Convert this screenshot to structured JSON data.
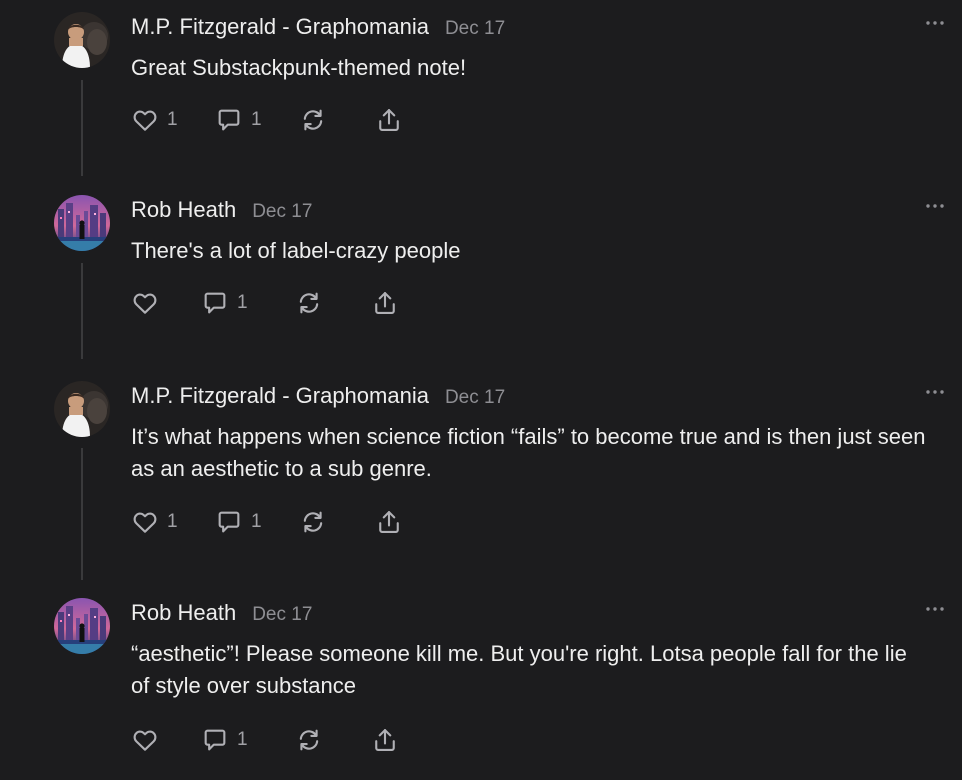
{
  "comments": [
    {
      "author": "M.P. Fitzgerald - Graphomania",
      "date": "Dec 17",
      "avatar_icon": "man-with-dog-avatar",
      "text": "Great Substackpunk-themed note!",
      "likes": "1",
      "replies": "1"
    },
    {
      "author": "Rob Heath",
      "date": "Dec 17",
      "avatar_icon": "cyberpunk-city-avatar",
      "text": "There's a lot of label-crazy people",
      "likes": "",
      "replies": "1"
    },
    {
      "author": "M.P. Fitzgerald - Graphomania",
      "date": "Dec 17",
      "avatar_icon": "man-with-dog-avatar",
      "text": "It’s what happens when science fiction “fails” to become true and is then just seen as an aesthetic to a sub genre.",
      "likes": "1",
      "replies": "1"
    },
    {
      "author": "Rob Heath",
      "date": "Dec 17",
      "avatar_icon": "cyberpunk-city-avatar",
      "text": "“aesthetic”! Please someone kill me. But you're right. Lotsa people fall for the lie of style over substance",
      "likes": "",
      "replies": "1"
    }
  ],
  "icons": {
    "like": "heart-icon",
    "reply": "comment-bubble-icon",
    "restack": "restack-arrows-icon",
    "share": "share-upload-icon",
    "more": "more-dots-icon"
  },
  "colors": {
    "background": "#1c1c1e",
    "text": "#eeeeee",
    "muted": "#8e8e93",
    "thread_line": "#3a3a3c"
  }
}
